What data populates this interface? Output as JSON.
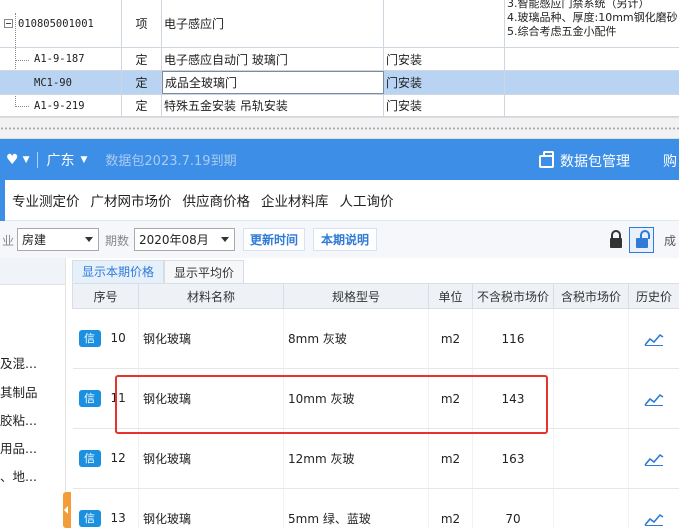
{
  "quota_grid": {
    "rows": [
      {
        "code": "010805001001",
        "type": "项",
        "name": "电子感应门",
        "unit": "",
        "level": 0
      },
      {
        "code": "A1-9-187",
        "type": "定",
        "name": "电子感应自动门 玻璃门",
        "unit": "门安装",
        "level": 1
      },
      {
        "code": "MC1-90",
        "type": "定",
        "name": "成品全玻璃门",
        "unit": "门安装",
        "level": 1,
        "selected": true
      },
      {
        "code": "A1-9-219",
        "type": "定",
        "name": "特殊五金安装 吊轨安装",
        "unit": "门安装",
        "level": 1
      }
    ],
    "features": [
      "3.智能感应门禁系统（另计）",
      "4.玻璃品种、厚度:10mm钢化磨砂",
      "5.综合考虑五金小配件"
    ]
  },
  "header": {
    "region": "广东",
    "expire_text": "数据包2023.7.19到期",
    "pkg_label": "数据包管理",
    "buy_label": "购"
  },
  "source_tabs": [
    "专业测定价",
    "广材网市场价",
    "供应商价格",
    "企业材料库",
    "人工询价"
  ],
  "filter": {
    "industry_label": "业",
    "industry_value": "房建",
    "period_label": "期数",
    "period_value": "2020年08月",
    "update_btn": "更新时间",
    "explain_btn": "本期说明",
    "cut_text": "成"
  },
  "left_panel": {
    "items": [
      "及混...",
      "其制品",
      "胶粘...",
      "用品...",
      "、地..."
    ]
  },
  "price_tabs": [
    "显示本期价格",
    "显示平均价"
  ],
  "price_table": {
    "columns": [
      "序号",
      "材料名称",
      "规格型号",
      "单位",
      "不含税市场价",
      "含税市场价",
      "历史价"
    ],
    "badge": "信",
    "rows": [
      {
        "no": "10",
        "name": "钢化玻璃",
        "spec": "8mm 灰玻",
        "unit": "m2",
        "price_ex": "116",
        "price_in": ""
      },
      {
        "no": "11",
        "name": "钢化玻璃",
        "spec": "10mm 灰玻",
        "unit": "m2",
        "price_ex": "143",
        "price_in": ""
      },
      {
        "no": "12",
        "name": "钢化玻璃",
        "spec": "12mm 灰玻",
        "unit": "m2",
        "price_ex": "163",
        "price_in": ""
      },
      {
        "no": "13",
        "name": "钢化玻璃",
        "spec": "5mm 绿、蓝玻",
        "unit": "m2",
        "price_ex": "70",
        "price_in": ""
      }
    ]
  },
  "colors": {
    "brand_blue": "#3d8ee6",
    "link_blue": "#2f7bd6",
    "badge_blue": "#1b8fe0",
    "highlight_red": "#e8322c",
    "selected_row": "#b9d3f3",
    "collapse_orange": "#f39c3a"
  }
}
